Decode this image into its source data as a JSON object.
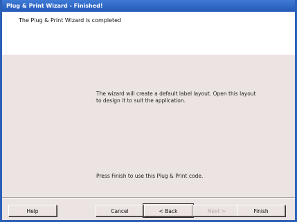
{
  "window": {
    "title": "Plug & Print Wizard - Finished!"
  },
  "header": {
    "text": "The Plug & Print Wizard is completed"
  },
  "content": {
    "message": "The wizard will create a default label layout. Open this layout to design it to suit the application.",
    "finish_hint": "Press Finish to use this Plug & Print code."
  },
  "buttons": {
    "help": "Help",
    "cancel": "Cancel",
    "back": "< Back",
    "next": "Next >",
    "finish": "Finish"
  }
}
